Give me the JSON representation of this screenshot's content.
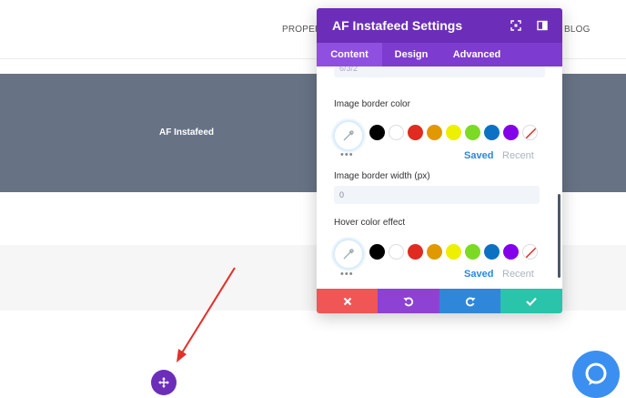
{
  "nav": {
    "properties_label": "PROPERT",
    "blog_label": "BLOG"
  },
  "hero": {
    "title": "AF Instafeed"
  },
  "modal": {
    "title": "AF Instafeed Settings",
    "tabs": [
      {
        "label": "Content",
        "active": true
      },
      {
        "label": "Design",
        "active": false
      },
      {
        "label": "Advanced",
        "active": false
      }
    ],
    "partial_value": "6/3/2",
    "image_border_color": {
      "label": "Image border color",
      "saved_label": "Saved",
      "recent_label": "Recent"
    },
    "image_border_width": {
      "label": "Image border width (px)",
      "value": "0"
    },
    "hover_color_effect": {
      "label": "Hover color effect",
      "saved_label": "Saved",
      "recent_label": "Recent"
    },
    "swatch_colors": [
      "#000000",
      "#ffffff",
      "#e02b20",
      "#e09900",
      "#edf000",
      "#7cda24",
      "#0c71c3",
      "#8300e9"
    ]
  },
  "colors": {
    "primary_purple": "#6c2eb9",
    "cancel_red": "#ef5655",
    "undo_purple": "#8e42d3",
    "redo_blue": "#2f87d9",
    "save_teal": "#29c4a9",
    "hero_slate": "#677385",
    "annotation_arrow": "#e3302a"
  },
  "icons": {
    "move": "move-arrows-icon",
    "chat": "chat-bubble-icon",
    "expand": "expand-icon",
    "sidebar": "sidebar-toggle-icon",
    "eyedropper": "eyedropper-icon",
    "cancel": "close-icon",
    "undo": "undo-icon",
    "redo": "redo-icon",
    "save": "check-icon"
  }
}
